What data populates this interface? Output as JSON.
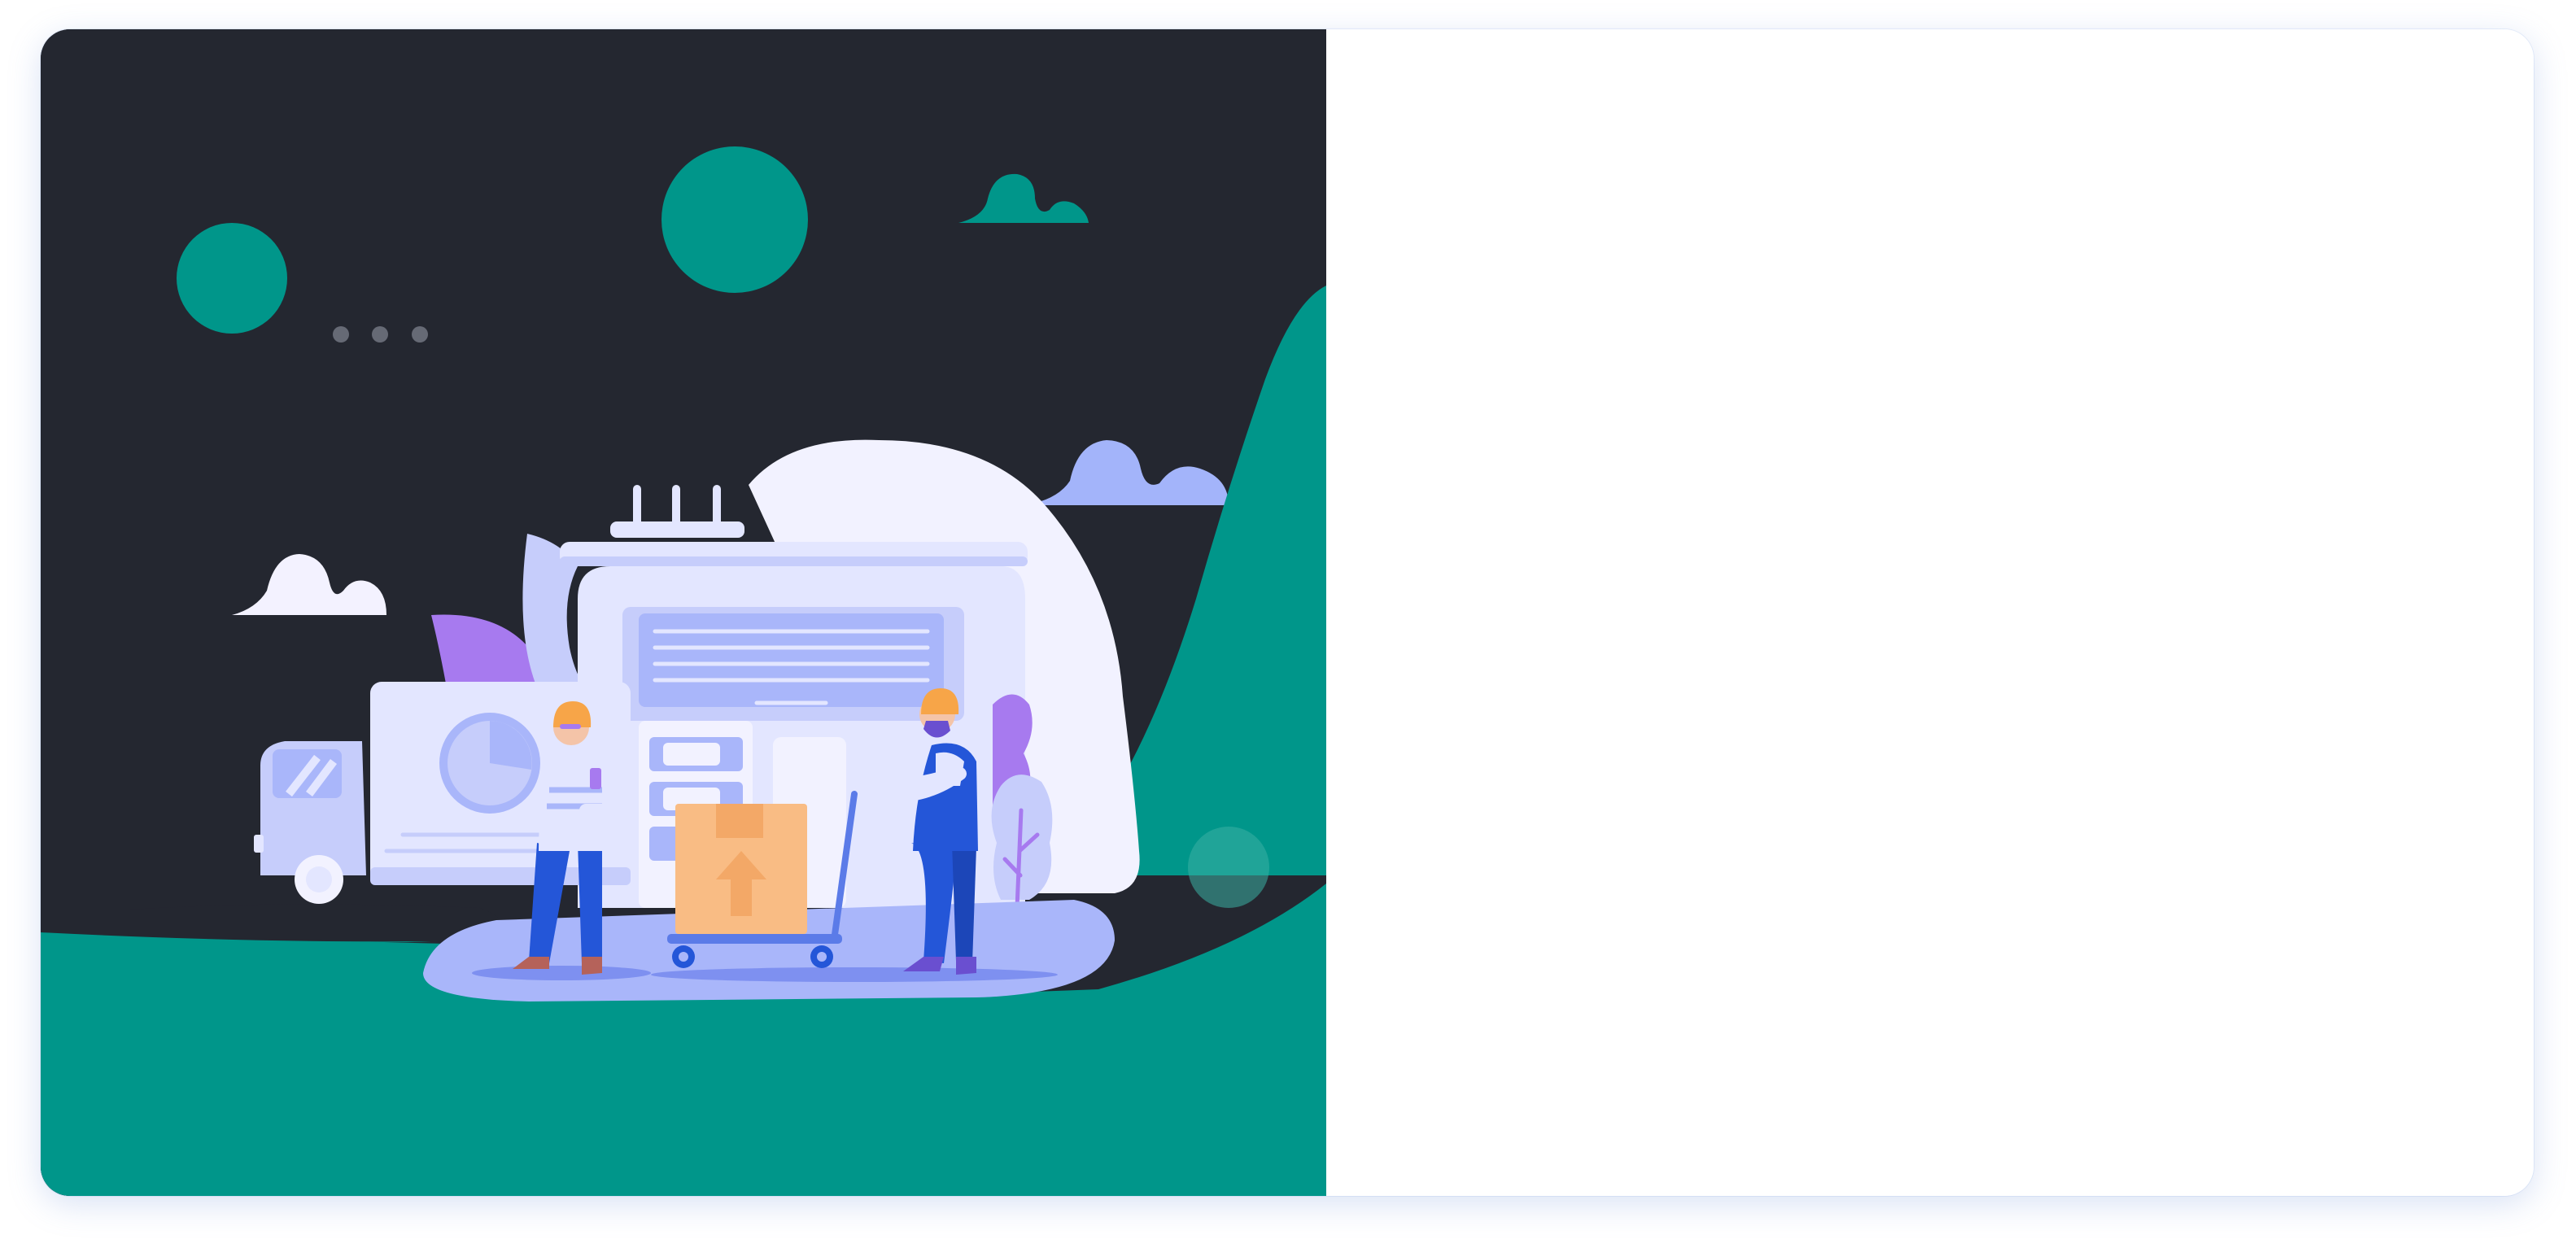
{
  "colors": {
    "panel_background": "#242730",
    "accent_teal": "#00968A",
    "cloud_periwinkle": "#A3B4FA",
    "cloud_white": "#F2F2FF",
    "building_light": "#E3E6FF",
    "building_mid": "#C6CDFB",
    "accent_purple": "#A77AEF",
    "box_orange": "#F9BC84",
    "worker_blue": "#2456D8",
    "helmet_orange": "#F7A548",
    "right_panel": "#FFFFFF"
  },
  "illustration": {
    "subject": "warehouse-logistics-scene",
    "icons": [
      "delivery-truck-icon",
      "warehouse-building-icon",
      "cardboard-box-icon",
      "hand-trolley-icon",
      "pie-chart-icon",
      "cloud-icon",
      "moon-circle-icon",
      "plant-icon"
    ],
    "people": [
      "worker-with-phone",
      "worker-pushing-trolley"
    ]
  },
  "form_panel": {}
}
